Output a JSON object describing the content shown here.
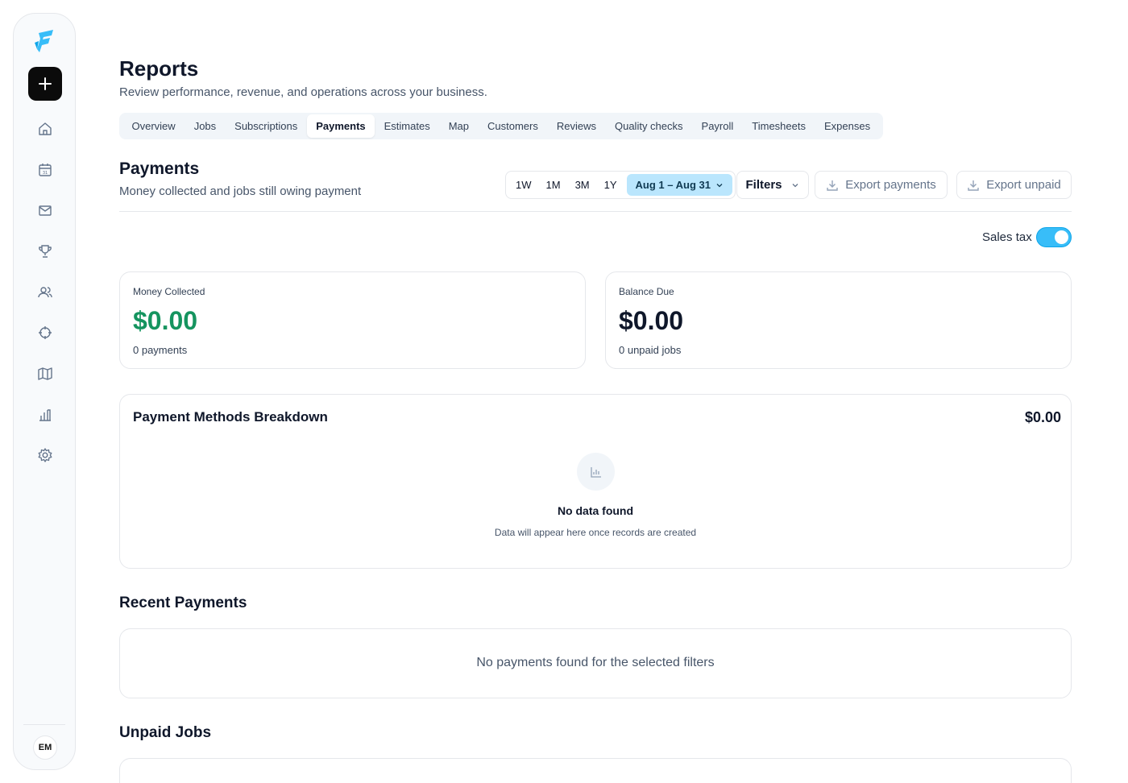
{
  "sidebar": {
    "avatar_initials": "EM",
    "nav_icons": [
      "home-icon",
      "calendar-icon",
      "mail-icon",
      "trophy-icon",
      "users-icon",
      "crosshair-icon",
      "map-icon",
      "bar-chart-icon",
      "gear-icon"
    ]
  },
  "header": {
    "title": "Reports",
    "subtitle": "Review performance, revenue, and operations across your business."
  },
  "tabs": [
    {
      "label": "Overview"
    },
    {
      "label": "Jobs"
    },
    {
      "label": "Subscriptions"
    },
    {
      "label": "Payments",
      "active": true
    },
    {
      "label": "Estimates"
    },
    {
      "label": "Map"
    },
    {
      "label": "Customers"
    },
    {
      "label": "Reviews"
    },
    {
      "label": "Quality checks"
    },
    {
      "label": "Payroll"
    },
    {
      "label": "Timesheets"
    },
    {
      "label": "Expenses"
    }
  ],
  "section": {
    "title": "Payments",
    "subtitle": "Money collected and jobs still owing payment"
  },
  "toolbar": {
    "ranges": [
      "1W",
      "1M",
      "3M",
      "1Y"
    ],
    "date_range": "Aug 1 – Aug 31",
    "filters_label": "Filters",
    "export_payments_label": "Export payments",
    "export_unpaid_label": "Export unpaid"
  },
  "sales_tax": {
    "label": "Sales tax",
    "enabled": true
  },
  "stats": {
    "money_collected": {
      "label": "Money Collected",
      "value": "$0.00",
      "sub": "0 payments",
      "color": "#15945f"
    },
    "balance_due": {
      "label": "Balance Due",
      "value": "$0.00",
      "sub": "0 unpaid jobs"
    }
  },
  "breakdown": {
    "title": "Payment Methods Breakdown",
    "total": "$0.00",
    "empty_title": "No data found",
    "empty_sub": "Data will appear here once records are created"
  },
  "recent_payments": {
    "title": "Recent Payments",
    "empty": "No payments found for the selected filters"
  },
  "unpaid_jobs": {
    "title": "Unpaid Jobs"
  },
  "colors": {
    "accent": "#38bdf8",
    "accent_light": "#bae6fd",
    "success": "#15945f"
  }
}
